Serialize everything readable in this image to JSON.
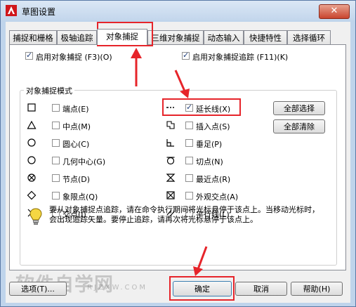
{
  "window": {
    "title": "草图设置",
    "close_symbol": "✕"
  },
  "tabs": [
    {
      "label": "捕捉和栅格"
    },
    {
      "label": "极轴追踪"
    },
    {
      "label": "对象捕捉"
    },
    {
      "label": "三维对象捕捉"
    },
    {
      "label": "动态输入"
    },
    {
      "label": "快捷特性"
    },
    {
      "label": "选择循环"
    }
  ],
  "options": {
    "snap_on": {
      "label": "启用对象捕捉 (F3)(O)",
      "checked": true
    },
    "track_on": {
      "label": "启用对象捕捉追踪 (F11)(K)",
      "checked": true
    }
  },
  "group_title": "对象捕捉模式",
  "modes_left": [
    {
      "label": "端点(E)",
      "icon": "square-icon"
    },
    {
      "label": "中点(M)",
      "icon": "triangle-icon"
    },
    {
      "label": "圆心(C)",
      "icon": "circle-icon"
    },
    {
      "label": "几何中心(G)",
      "icon": "circle-icon"
    },
    {
      "label": "节点(D)",
      "icon": "node-icon"
    },
    {
      "label": "象限点(Q)",
      "icon": "diamond-icon"
    },
    {
      "label": "交点(I)",
      "icon": "cross-icon"
    }
  ],
  "modes_right": [
    {
      "label": "延长线(X)",
      "icon": "extension-icon",
      "checked": true
    },
    {
      "label": "插入点(S)",
      "icon": "insert-icon"
    },
    {
      "label": "垂足(P)",
      "icon": "perpendicular-icon"
    },
    {
      "label": "切点(N)",
      "icon": "tangent-icon"
    },
    {
      "label": "最近点(R)",
      "icon": "nearest-icon"
    },
    {
      "label": "外观交点(A)",
      "icon": "apparent-intersection-icon"
    },
    {
      "label": "平行线(L)",
      "icon": "parallel-icon"
    }
  ],
  "side_buttons": {
    "select_all": "全部选择",
    "clear_all": "全部清除"
  },
  "info_text": "要从对象捕捉点追踪，请在命令执行期间将光标悬停于该点上。当移动光标时，会出现追踪矢量。要停止追踪，请再次将光标悬停于该点上。",
  "footer": {
    "options": "选项(T)...",
    "ok": "确定",
    "cancel": "取消",
    "help": "帮助(H)"
  },
  "watermark": {
    "main": "软件自学网",
    "sub": "RJZXW.COM"
  },
  "accent_color": "#e6242a"
}
